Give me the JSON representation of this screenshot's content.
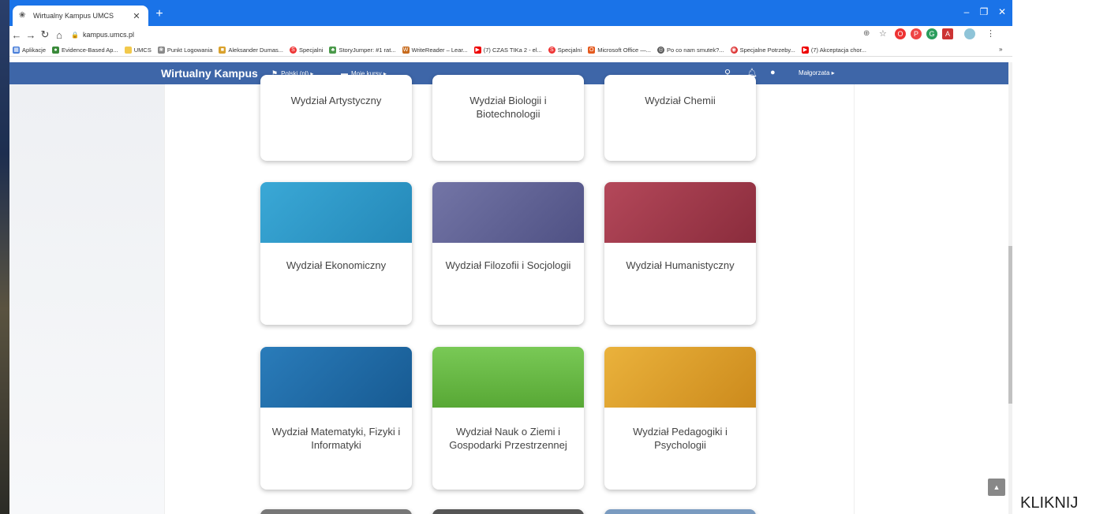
{
  "browser": {
    "tab_title": "Wirtualny Kampus UMCS",
    "url": "kampus.umcs.pl",
    "bookmarks": [
      "Aplikacje",
      "Evidence-Based Ap...",
      "UMCS",
      "Punkt Logowania",
      "Aleksander Dumas...",
      "Specjalni",
      "StoryJumper: #1 rat...",
      "WriteReader – Lear...",
      "(7) CZAS TIKa 2 - el...",
      "Specjalni",
      "Microsoft Office —...",
      "Po co nam smutek?...",
      "Specjalne Potrzeby...",
      "(7) Akceptacja chor..."
    ]
  },
  "site": {
    "brand": "Wirtualny Kampus",
    "language": "Polski (pl) ▸",
    "my_courses": "Moje kursy ▸",
    "user": "Małgorzata ▸"
  },
  "cards": [
    {
      "label": "Wydział Artystyczny",
      "color": ""
    },
    {
      "label": "Wydział Biologii i Biotechnologii",
      "color": ""
    },
    {
      "label": "Wydział Chemii",
      "color": ""
    },
    {
      "label": "Wydział Ekonomiczny",
      "color": "#2d9bc9"
    },
    {
      "label": "Wydział Filozofii i Socjologii",
      "color": "#5f6193"
    },
    {
      "label": "Wydział Humanistyczny",
      "color": "#a13a4a"
    },
    {
      "label": "Wydział Matematyki, Fizyki i Informatyki",
      "color": "#1f6aa6"
    },
    {
      "label": "Wydział Nauk o Ziemi i Gospodarki Przestrzennej",
      "color": "#6cbd45"
    },
    {
      "label": "Wydział Pedagogiki i Psychologii",
      "color": "#e0a22c"
    }
  ],
  "caption": "KLIKNIJ"
}
